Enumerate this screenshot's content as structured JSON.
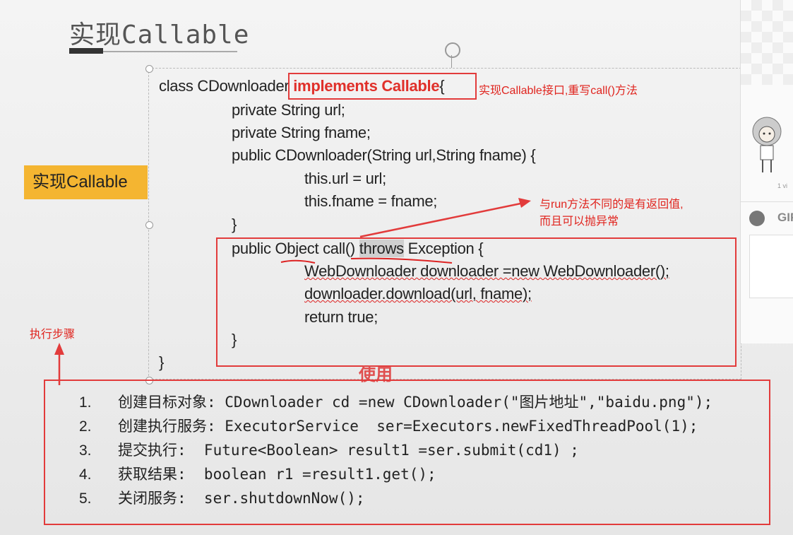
{
  "slide": {
    "title": "实现Callable",
    "badge": "实现Callable"
  },
  "code": {
    "line1_pre": "class CDownloader ",
    "line1_kw": "implements Callable",
    "line1_post": "{",
    "line2": "private String url;",
    "line3": "private String fname;",
    "line4": "public CDownloader(String url,String fname) {",
    "line5": "this.url = url;",
    "line6": "this.fname = fname;",
    "line7": "}",
    "line8_a": "public Object call() ",
    "line8_hl": "throws",
    "line8_b": " Exception {",
    "line9": "WebDownloader downloader =new WebDownloader();",
    "line10": "downloader.download(url, fname);",
    "line11": "return true;",
    "line12": "}",
    "line13": "}"
  },
  "notes": {
    "implements": "实现Callable接口,重写call()方法",
    "difference_1": "与run方法不同的是有返回值,",
    "difference_2": "而且可以抛异常",
    "steps_label": "执行步骤",
    "usage_title": "使用"
  },
  "usage": [
    {
      "num": "1.",
      "text": "创建目标对象: CDownloader cd =new CDownloader(\"图片地址\",\"baidu.png\");"
    },
    {
      "num": "2.",
      "text": "创建执行服务: ExecutorService  ser=Executors.newFixedThreadPool(1);"
    },
    {
      "num": "3.",
      "text": "提交执行:  Future<Boolean> result1 =ser.submit(cd1) ;"
    },
    {
      "num": "4.",
      "text": "获取结果:  boolean r1 =result1.get();"
    },
    {
      "num": "5.",
      "text": "关闭服务:  ser.shutdownNow();"
    }
  ],
  "panel": {
    "meta": "1 vi",
    "gif_label": "GIF"
  },
  "colors": {
    "accent_red": "#e23b3b",
    "badge_orange": "#f4b531"
  }
}
